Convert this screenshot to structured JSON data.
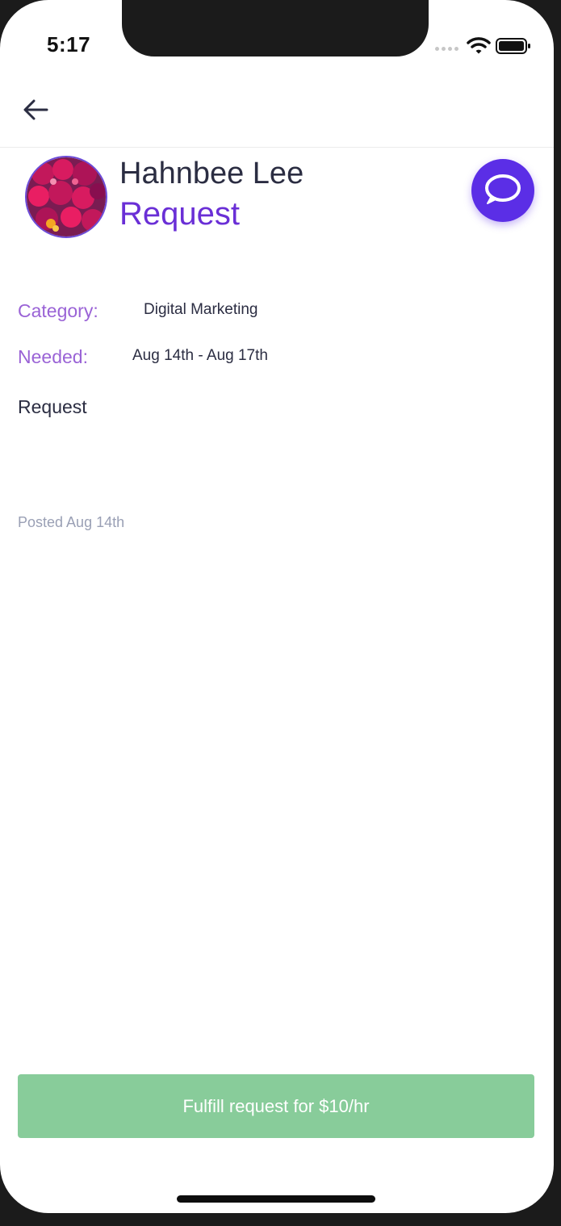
{
  "status_bar": {
    "time": "5:17",
    "icons": [
      "signal-dots-icon",
      "wifi-icon",
      "battery-icon"
    ]
  },
  "nav": {
    "back_icon": "arrow-left-icon"
  },
  "profile": {
    "name": "Hahnbee Lee",
    "subtitle": "Request",
    "avatar": "flower-photo-avatar",
    "chat_icon": "chat-bubble-icon"
  },
  "details": {
    "category_label": "Category:",
    "category_value": "Digital Marketing",
    "needed_label": "Needed:",
    "needed_value": "Aug 14th - Aug 17th"
  },
  "description": "Request",
  "posted": "Posted Aug 14th",
  "action": {
    "fulfill_label": "Fulfill request for $10/hr"
  },
  "colors": {
    "accent_purple": "#6a2fd6",
    "label_purple": "#9a63d6",
    "chat_button": "#5b2ee6",
    "fulfill_button": "#88cc9a",
    "text_dark": "#2b2d42",
    "muted_text": "#9aa0b5"
  }
}
